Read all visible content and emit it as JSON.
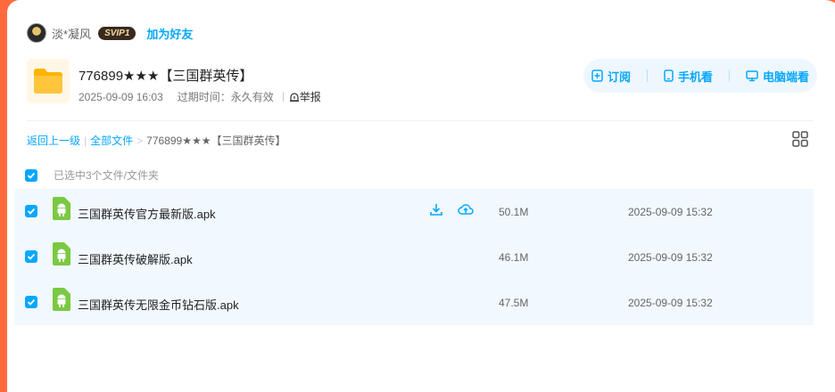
{
  "user": {
    "name": "淡*凝风",
    "vip_badge": "SVIP1",
    "add_friend": "加为好友"
  },
  "share": {
    "title": "776899★★★【三国群英传】",
    "created": "2025-09-09 16:03",
    "expire_label": "过期时间：永久有效",
    "report": "举报"
  },
  "actions": {
    "subscribe": "订阅",
    "phone_view": "手机看",
    "pc_view": "电脑端看"
  },
  "breadcrumb": {
    "back": "返回上一级",
    "all_files": "全部文件",
    "current": "776899★★★【三国群英传】"
  },
  "selection": {
    "status": "已选中3个文件/文件夹"
  },
  "files": [
    {
      "name": "三国群英传官方最新版.apk",
      "size": "50.1M",
      "time": "2025-09-09 15:32"
    },
    {
      "name": "三国群英传破解版.apk",
      "size": "46.1M",
      "time": "2025-09-09 15:32"
    },
    {
      "name": "三国群英传无限金币钻石版.apk",
      "size": "47.5M",
      "time": "2025-09-09 15:32"
    }
  ],
  "colors": {
    "accent": "#06a7ff",
    "row_bg": "#f1f8fe",
    "page_bg": "#ff6a3d",
    "folder": "#ffc53d",
    "android": "#7ac943"
  }
}
